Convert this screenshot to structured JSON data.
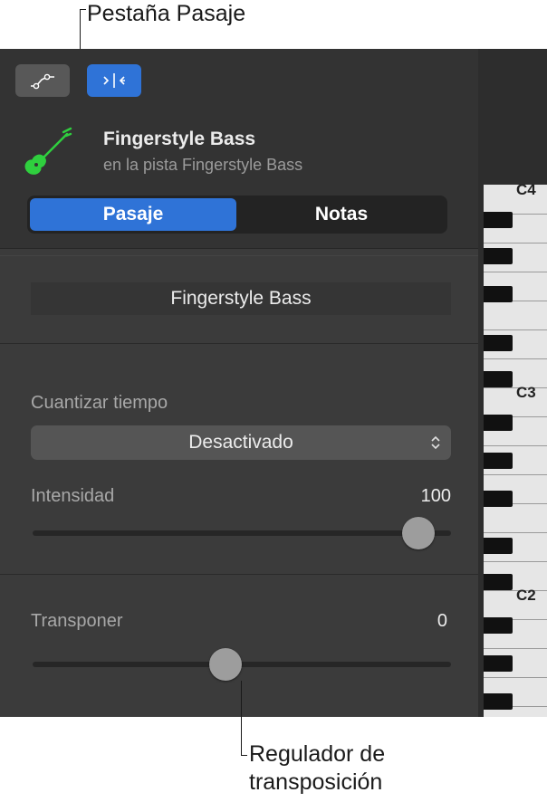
{
  "callouts": {
    "region_tab": "Pestaña Pasaje",
    "transpose_slider": "Regulador de transposición",
    "transpose_slider_line1": "Regulador de",
    "transpose_slider_line2": "transposición"
  },
  "toolbar": {
    "automation_icon": "automation-curve-icon",
    "editor_icon": "editor-scissors-icon",
    "editor_active": true
  },
  "track": {
    "icon": "bass-guitar-icon",
    "icon_color": "#2fcf3e",
    "name": "Fingerstyle Bass",
    "subtitle": "en la pista Fingerstyle Bass"
  },
  "tabs": [
    {
      "label": "Pasaje",
      "active": true
    },
    {
      "label": "Notas",
      "active": false
    }
  ],
  "region": {
    "name": "Fingerstyle Bass"
  },
  "quantize": {
    "label": "Cuantizar tiempo",
    "value": "Desactivado"
  },
  "strength": {
    "label": "Intensidad",
    "value": "100",
    "fraction": 1.0
  },
  "transpose": {
    "label": "Transponer",
    "value": "0",
    "fraction": 0.5
  },
  "piano": {
    "labels": [
      "C4",
      "C3",
      "C2"
    ]
  },
  "colors": {
    "accent": "#2f73d7",
    "panel": "#3b3b3b"
  }
}
